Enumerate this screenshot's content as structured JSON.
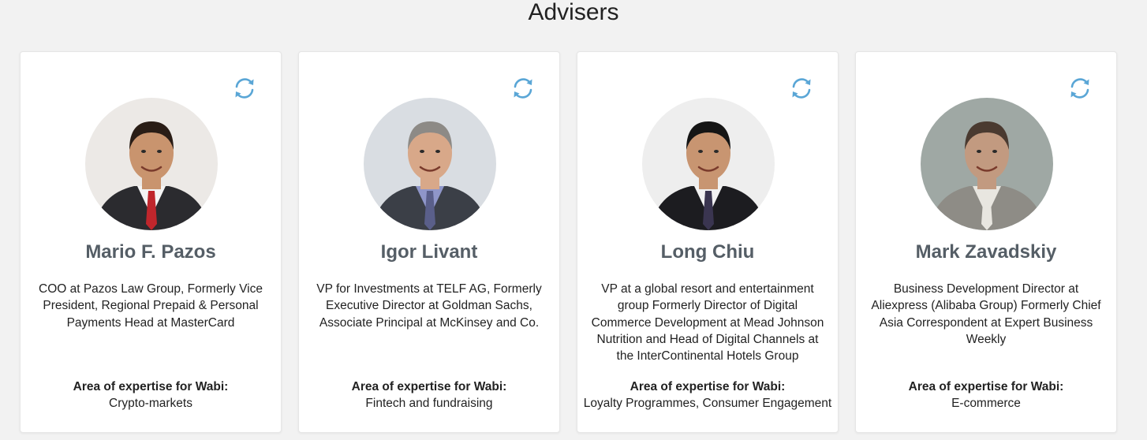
{
  "section": {
    "title": "Advisers"
  },
  "expertise_label": "Area of expertise for Wabi:",
  "advisers": [
    {
      "name": "Mario F. Pazos",
      "bio": "COO at Pazos Law Group, Formerly Vice President, Regional Prepaid & Personal Payments Head at MasterCard",
      "expertise": "Crypto-markets",
      "photo": {
        "background": "#ece9e6",
        "skin": "#c9946e",
        "hair": "#2a1d16",
        "suit": "#2b2b2f",
        "shirt": "#f4f4f4",
        "tie": "#c0262c"
      }
    },
    {
      "name": "Igor Livant",
      "bio": "VP for Investments at TELF AG, Formerly Executive Director at Goldman Sachs, Associate Principal at McKinsey and Co.",
      "expertise": "Fintech and fundraising",
      "photo": {
        "background": "#d9dde2",
        "skin": "#d8a889",
        "hair": "#8d8a86",
        "suit": "#3b3f47",
        "shirt": "#8f96c9",
        "tie": "#5a5f8a"
      }
    },
    {
      "name": "Long Chiu",
      "bio": "VP at a global resort and entertainment group Formerly Director of Digital Commerce Development at Mead Johnson Nutrition and Head of Digital Channels at the InterContinental Hotels Group",
      "expertise": "Loyalty Programmes, Consumer Engagement",
      "photo": {
        "background": "#eeeeee",
        "skin": "#c89571",
        "hair": "#151515",
        "suit": "#1c1c20",
        "shirt": "#f2f2f2",
        "tie": "#3a3550"
      }
    },
    {
      "name": "Mark Zavadskiy",
      "bio": "Business Development Director at Aliexpress (Alibaba Group) Formerly Chief Asia Correspondent at Expert Business Weekly",
      "expertise": "E-commerce",
      "photo": {
        "background": "#9fa8a4",
        "skin": "#c29a80",
        "hair": "#4a3a30",
        "suit": "#8e8c86",
        "shirt": "#e8e6e0",
        "tie": "#e8e6e0"
      }
    }
  ],
  "icon_color": "#5aa6d6"
}
